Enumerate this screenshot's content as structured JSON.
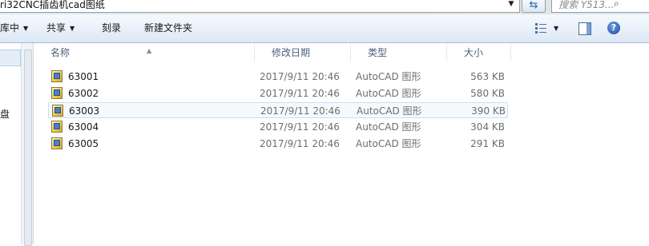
{
  "address": {
    "path": "ri32CNC插齿机cad图纸",
    "search_placeholder": "搜索 Y513..."
  },
  "toolbar": {
    "organize": "库中",
    "share": "共享",
    "burn": "刻录",
    "new_folder": "新建文件夹"
  },
  "nav": {
    "partial_label": "盘"
  },
  "columns": {
    "name": "名称",
    "date": "修改日期",
    "type": "类型",
    "size": "大小"
  },
  "files": [
    {
      "name": "63001",
      "date": "2017/9/11 20:46",
      "type": "AutoCAD 图形",
      "size": "563 KB"
    },
    {
      "name": "63002",
      "date": "2017/9/11 20:46",
      "type": "AutoCAD 图形",
      "size": "580 KB"
    },
    {
      "name": "63003",
      "date": "2017/9/11 20:46",
      "type": "AutoCAD 图形",
      "size": "390 KB"
    },
    {
      "name": "63004",
      "date": "2017/9/11 20:46",
      "type": "AutoCAD 图形",
      "size": "304 KB"
    },
    {
      "name": "63005",
      "date": "2017/9/11 20:46",
      "type": "AutoCAD 图形",
      "size": "291 KB"
    }
  ],
  "selected_row": 2,
  "icons": {
    "refresh": "refresh-icon",
    "search": "search-icon",
    "views": "view-details-icon",
    "preview_pane": "preview-pane-icon",
    "help": "help-icon",
    "file": "autocad-file-icon"
  },
  "colors": {
    "toolbar_top": "#f5f9fd",
    "toolbar_bottom": "#dde8f4",
    "selection_border": "#cfdcee",
    "help_blue": "#1f4e9c"
  }
}
